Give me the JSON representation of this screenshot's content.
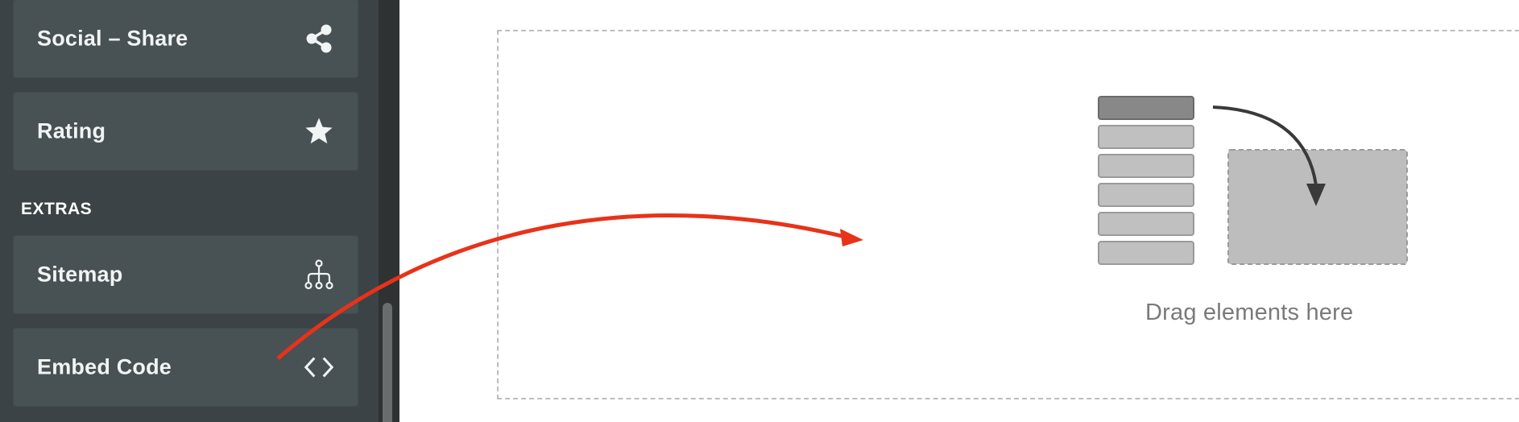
{
  "sidebar": {
    "items": [
      {
        "label": "Social – Share",
        "icon": "share-icon"
      },
      {
        "label": "Rating",
        "icon": "star-icon"
      },
      {
        "label": "Sitemap",
        "icon": "sitemap-icon"
      },
      {
        "label": "Embed Code",
        "icon": "code-icon"
      }
    ],
    "section_heading": "EXTRAS"
  },
  "canvas": {
    "dropzone_text": "Drag elements here",
    "illustration": "drag-drop-illustration"
  },
  "colors": {
    "sidebar_bg": "#3c4346",
    "card_bg": "#485153",
    "annotation_arrow": "#e8321a"
  }
}
